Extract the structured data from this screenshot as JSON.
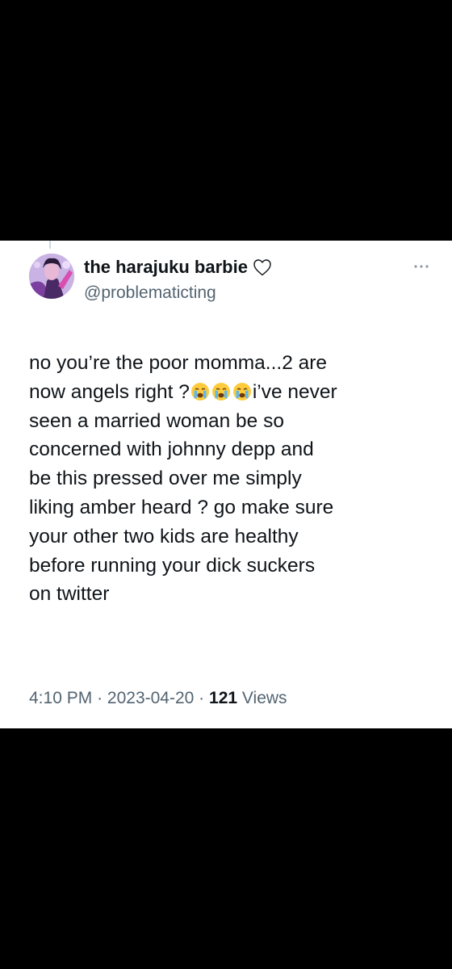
{
  "tweet": {
    "display_name": "the harajuku barbie",
    "handle": "@problematicting",
    "text_lines": [
      "no you’re the poor momma...2 are",
      "now angels right ?",
      "i’ve never",
      "seen a married woman be so",
      "concerned with johnny depp and",
      "be this pressed over me simply",
      "liking amber heard ? go make sure",
      "your other two kids are healthy",
      "before running your dick suckers",
      "on twitter"
    ],
    "time": "4:10 PM",
    "separator": "·",
    "date": "2023-04-20",
    "views_count": "121",
    "views_label": "Views"
  },
  "icons": {
    "name_badge": "heart-outline-icon",
    "menu": "more-dots-icon",
    "emoji": "loudly-crying-face-emoji"
  },
  "colors": {
    "background": "#000000",
    "card": "#ffffff",
    "text_primary": "#0f1419",
    "text_secondary": "#536471"
  }
}
